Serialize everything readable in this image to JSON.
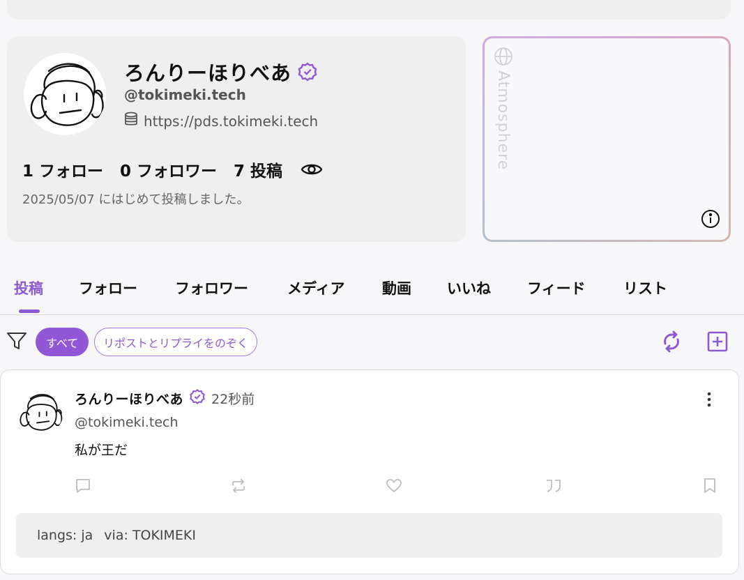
{
  "profile": {
    "display_name": "ろんりーほりべあ",
    "handle": "@tokimeki.tech",
    "pds_url": "https://pds.tokimeki.tech",
    "stats": {
      "follows": "1 フォロー",
      "followers": "0 フォロワー",
      "posts": "7 投稿"
    },
    "joined": "2025/05/07 にはじめて投稿しました。"
  },
  "atmosphere": {
    "label": "Atmosphere"
  },
  "tabs": [
    {
      "label": "投稿",
      "active": true
    },
    {
      "label": "フォロー"
    },
    {
      "label": "フォロワー"
    },
    {
      "label": "メディア"
    },
    {
      "label": "動画"
    },
    {
      "label": "いいね"
    },
    {
      "label": "フィード"
    },
    {
      "label": "リスト"
    }
  ],
  "filters": {
    "all": "すべて",
    "exclude_reposts_replies": "リポストとリプライをのぞく"
  },
  "post": {
    "author": "ろんりーほりべあ",
    "time": "22秒前",
    "handle": "@tokimeki.tech",
    "text": "私が王だ",
    "langs": "langs: ja",
    "via": "via: TOKIMEKI"
  },
  "icons": {
    "verified": "verified-badge-icon",
    "database": "database-icon",
    "eye": "eye-icon",
    "globe": "globe-icon",
    "info": "info-icon",
    "filter": "filter-icon",
    "refresh": "refresh-icon",
    "add": "add-square-icon",
    "more": "more-vertical-icon",
    "reply": "reply-icon",
    "repost": "repost-icon",
    "like": "heart-icon",
    "quote": "quote-icon",
    "bookmark": "bookmark-icon"
  },
  "colors": {
    "accent": "#8c5bd4",
    "chip_fill": "#9257d7",
    "card_bg": "#efefef"
  }
}
